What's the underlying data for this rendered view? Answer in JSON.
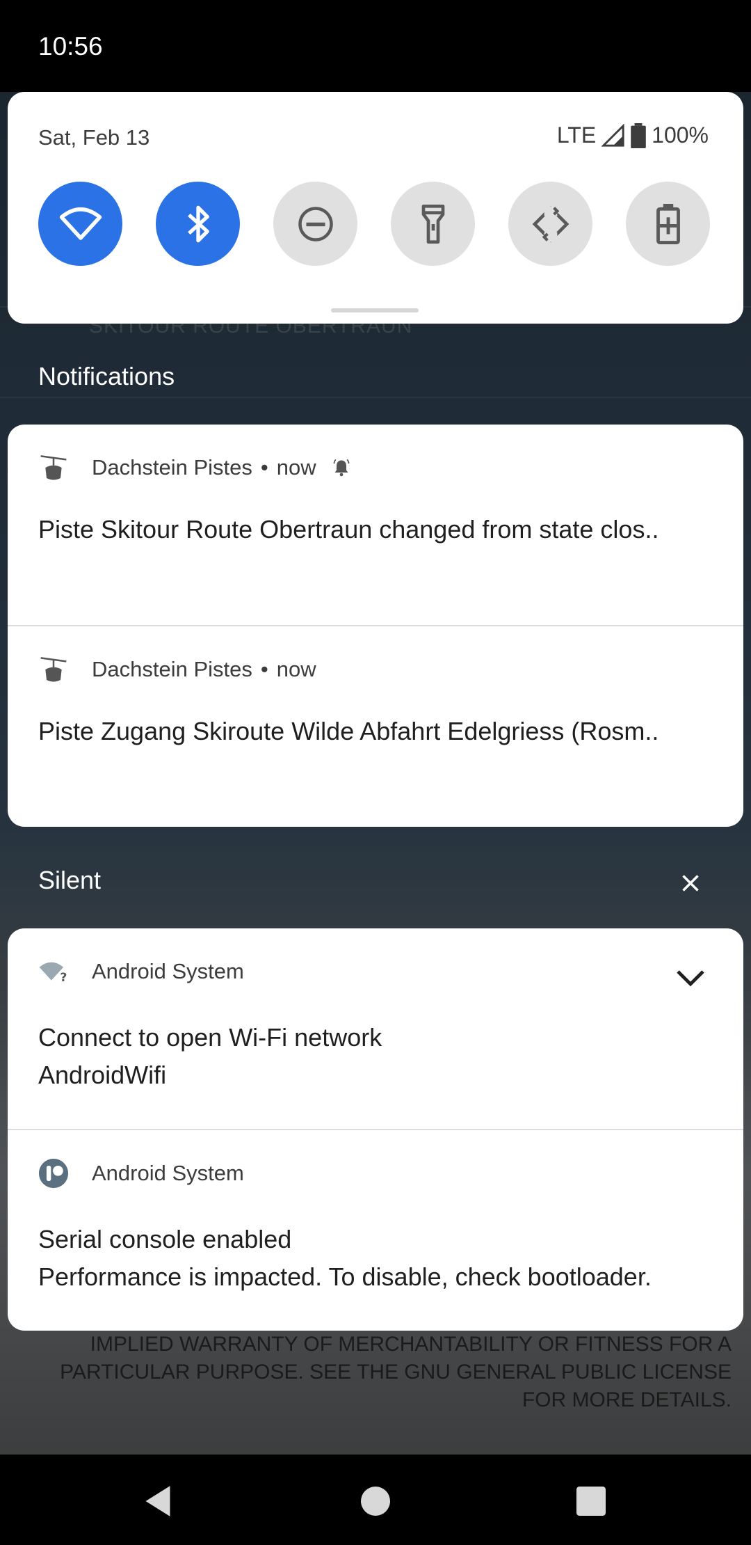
{
  "status_bar": {
    "time": "10:56"
  },
  "quick_settings": {
    "date": "Sat, Feb 13",
    "network": "LTE",
    "battery": "100%",
    "tiles": [
      {
        "name": "wifi",
        "state": "on",
        "icon": "wifi-icon"
      },
      {
        "name": "bluetooth",
        "state": "on",
        "icon": "bluetooth-icon"
      },
      {
        "name": "do-not-disturb",
        "state": "off",
        "icon": "dnd-icon"
      },
      {
        "name": "flashlight",
        "state": "off",
        "icon": "flashlight-icon"
      },
      {
        "name": "auto-rotate",
        "state": "off",
        "icon": "rotate-icon"
      },
      {
        "name": "battery-saver",
        "state": "off",
        "icon": "battery-saver-icon"
      }
    ]
  },
  "background_app": {
    "row_title": "SKITOUR ROUTE OBERTRAUN",
    "license_text": [
      "IMPLIED WARRANTY OF MERCHANTABILITY OR FITNESS FOR A",
      "PARTICULAR PURPOSE. SEE THE GNU GENERAL PUBLIC LICENSE",
      "FOR MORE DETAILS."
    ]
  },
  "sections": {
    "notifications_label": "Notifications",
    "silent_label": "Silent"
  },
  "notifications": [
    {
      "app": "Dachstein Pistes",
      "time": "now",
      "text": "Piste Skitour Route Obertraun changed from state clos..",
      "alerting": true
    },
    {
      "app": "Dachstein Pistes",
      "time": "now",
      "text": "Piste Zugang Skiroute Wilde Abfahrt Edelgriess (Rosm.."
    }
  ],
  "silent_notifications": [
    {
      "app": "Android System",
      "title": "Connect to open Wi-Fi network",
      "text": "AndroidWifi"
    },
    {
      "app": "Android System",
      "title": "Serial console enabled",
      "text": "Performance is impacted. To disable, check bootloader."
    }
  ],
  "colors": {
    "accent": "#2a72e5",
    "tile_off": "#e0e0e0"
  }
}
